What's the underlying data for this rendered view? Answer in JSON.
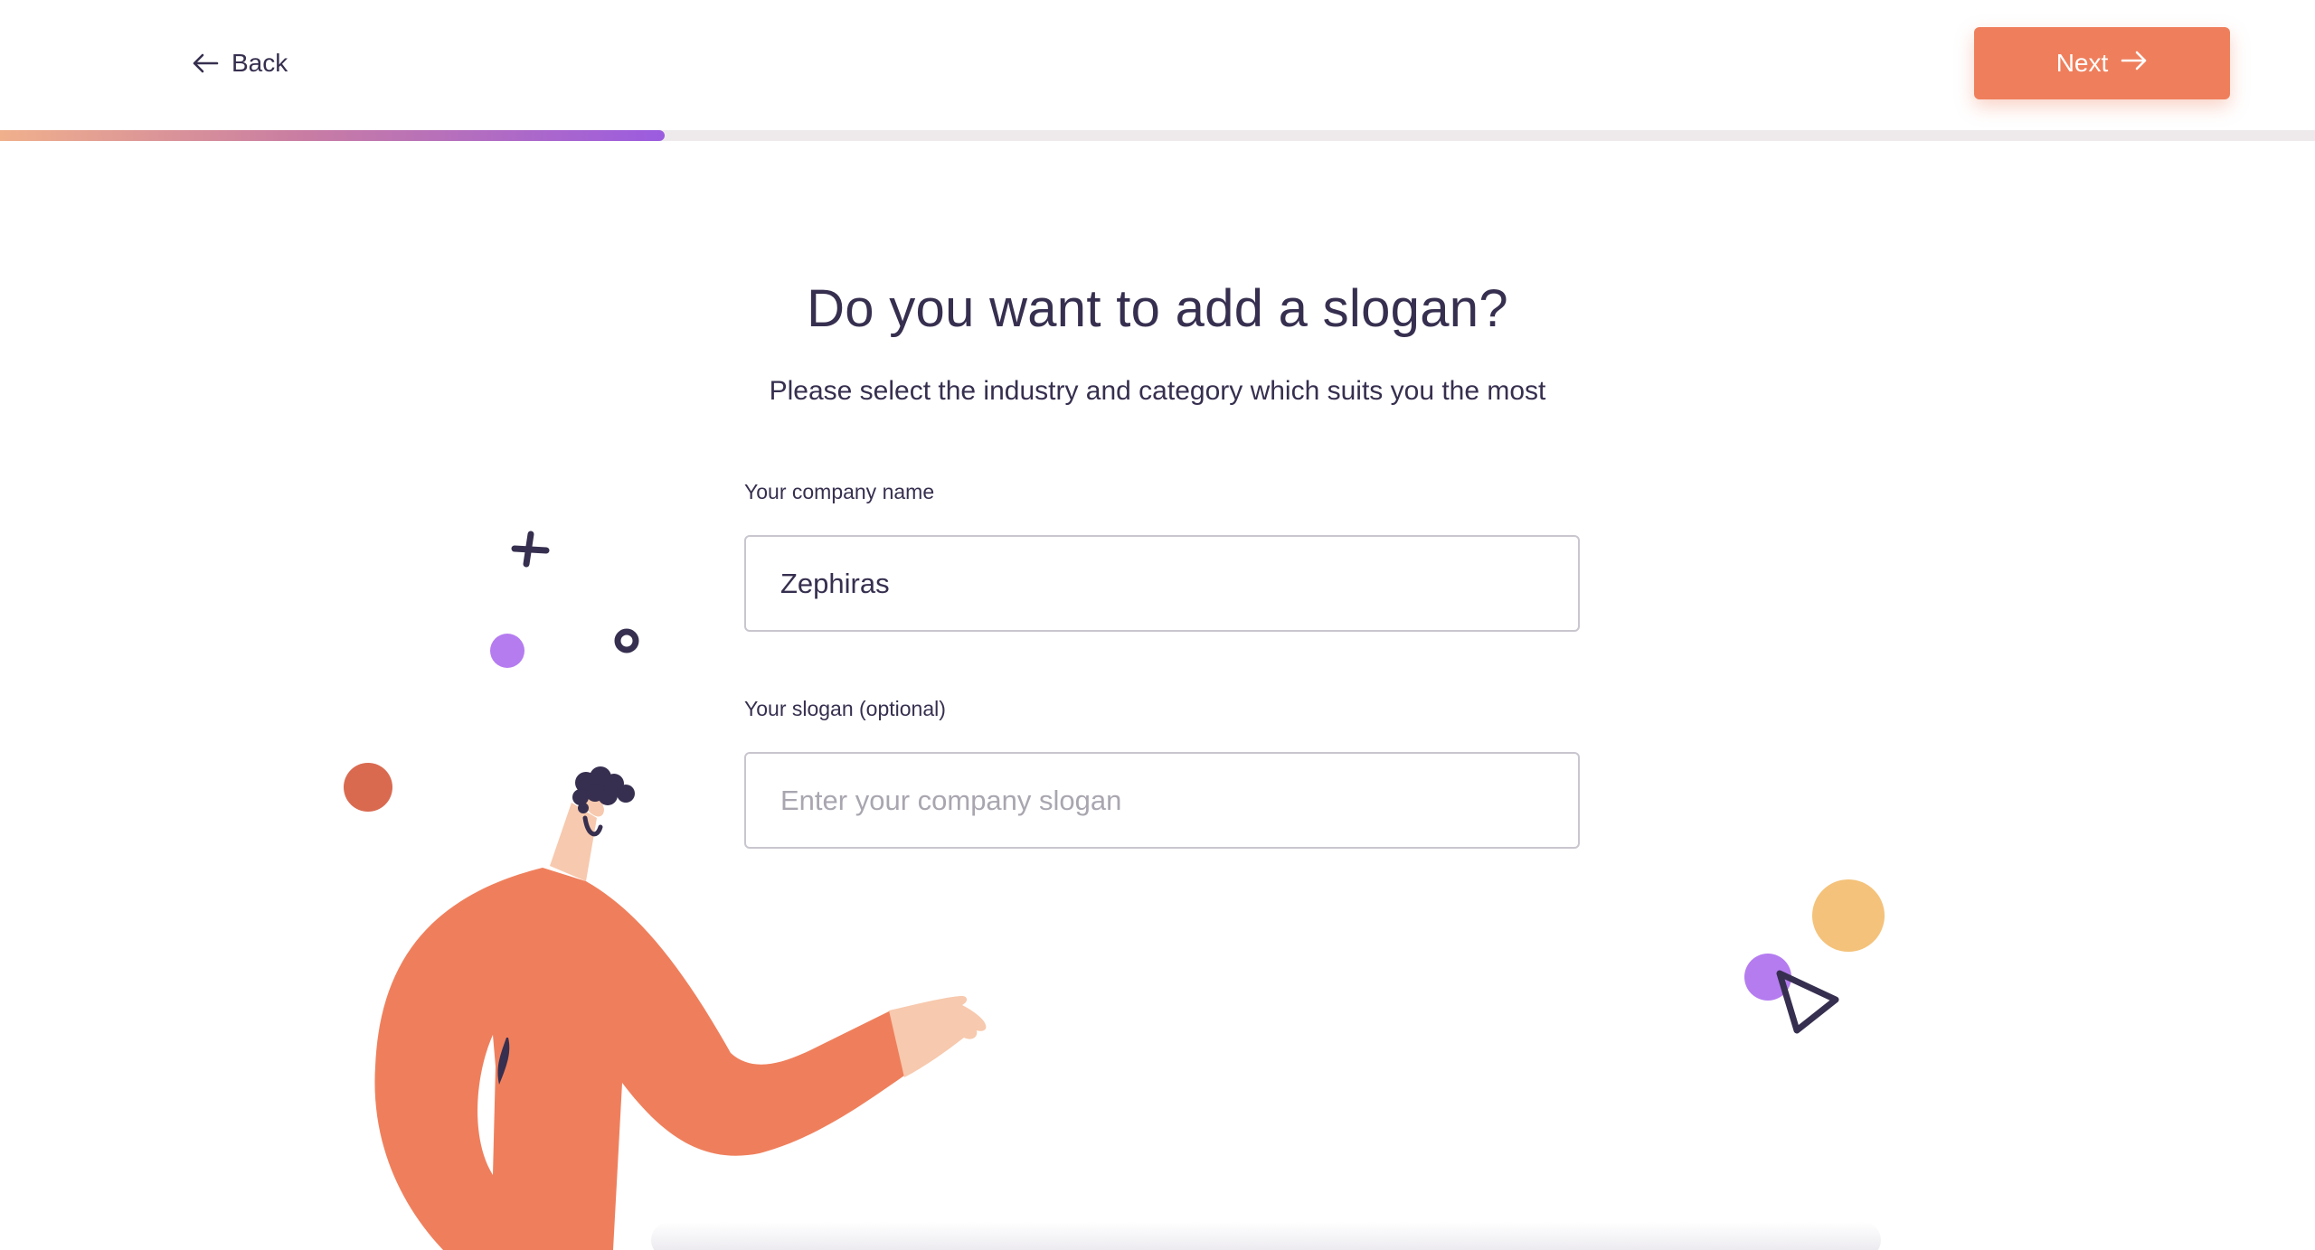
{
  "header": {
    "back_label": "Back",
    "next_label": "Next",
    "progress_fraction": 0.287
  },
  "main": {
    "title": "Do you want to add a slogan?",
    "subtitle": "Please select the industry and category which suits you the most",
    "company_name": {
      "label": "Your company name",
      "value": "Zephiras"
    },
    "slogan": {
      "label": "Your slogan (optional)",
      "value": "",
      "placeholder": "Enter your company slogan"
    }
  },
  "colors": {
    "accent": "#ef7f5c",
    "text": "#372f4f",
    "purple": "#b57cf0",
    "yellow": "#f4c27a",
    "red_dot": "#d96a50",
    "skin": "#f7c9ae"
  },
  "icons": {
    "back": "arrow-left-icon",
    "next": "arrow-right-icon"
  }
}
